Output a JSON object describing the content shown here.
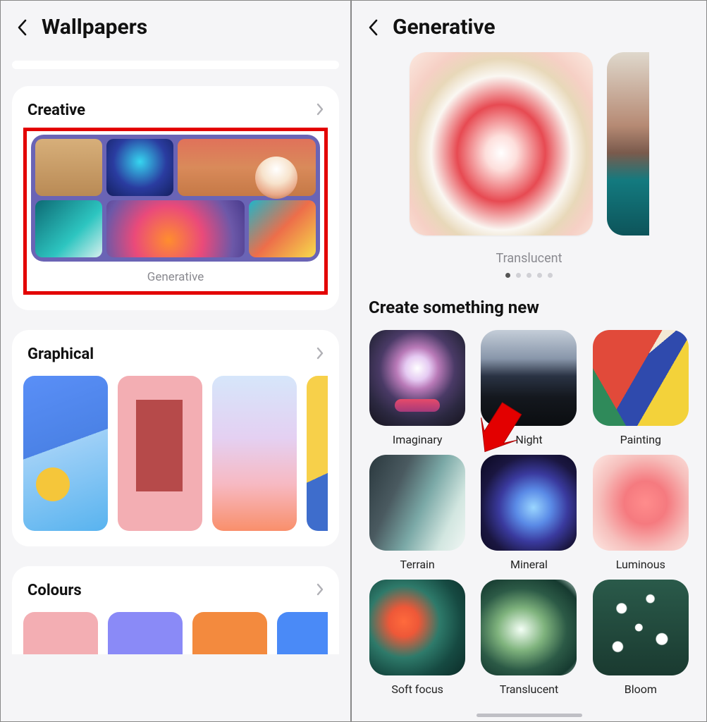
{
  "left": {
    "title": "Wallpapers",
    "sections": {
      "creative": {
        "header": "Creative",
        "tile_caption": "Generative"
      },
      "graphical": {
        "header": "Graphical"
      },
      "colours": {
        "header": "Colours",
        "swatches": [
          "#f3aeb3",
          "#8a8af7",
          "#f38a3e",
          "#4a8af7"
        ]
      }
    }
  },
  "right": {
    "title": "Generative",
    "preview_label": "Translucent",
    "dot_count": 5,
    "active_dot": 0,
    "create_heading": "Create something new",
    "categories": [
      {
        "key": "imaginary",
        "label": "Imaginary"
      },
      {
        "key": "night",
        "label": "Night"
      },
      {
        "key": "painting",
        "label": "Painting"
      },
      {
        "key": "terrain",
        "label": "Terrain"
      },
      {
        "key": "mineral",
        "label": "Mineral"
      },
      {
        "key": "luminous",
        "label": "Luminous"
      },
      {
        "key": "softfocus",
        "label": "Soft focus"
      },
      {
        "key": "translucent",
        "label": "Translucent"
      },
      {
        "key": "bloom",
        "label": "Bloom"
      }
    ]
  },
  "annotation": {
    "arrow_color": "#e30000"
  }
}
